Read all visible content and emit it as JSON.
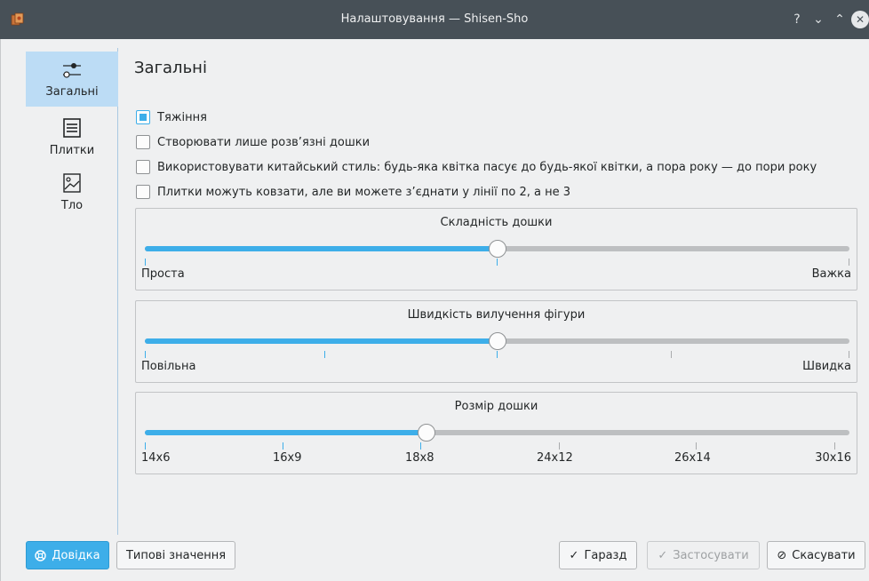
{
  "window": {
    "title": "Налаштовування — Shisen-Sho",
    "help_glyph": "?",
    "min_glyph": "⌄",
    "max_glyph": "⌃",
    "close_glyph": "✕"
  },
  "sidebar": {
    "items": [
      {
        "label": "Загальні",
        "icon": "sliders-icon",
        "active": true
      },
      {
        "label": "Плитки",
        "icon": "tiles-icon",
        "active": false
      },
      {
        "label": "Тло",
        "icon": "image-icon",
        "active": false
      }
    ]
  },
  "page": {
    "title": "Загальні"
  },
  "options": [
    {
      "label": "Тяжіння",
      "checked": true
    },
    {
      "label": "Створювати лише розв’язні дошки",
      "checked": false
    },
    {
      "label": "Використовувати китайський стиль: будь-яка квітка пасує до будь-якої квітки, а пора року — до пори року",
      "checked": false
    },
    {
      "label": "Плитки можуть ковзати, але ви можете з’єднати у лінії по 2, а не 3",
      "checked": false
    }
  ],
  "sliders": [
    {
      "title": "Складність дошки",
      "value_fraction": 0.5,
      "min_label": "Проста",
      "max_label": "Важка"
    },
    {
      "title": "Швидкість вилучення фігури",
      "value_fraction": 0.5,
      "min_label": "Повільна",
      "max_label": "Швидка"
    },
    {
      "title": "Розмір дошки",
      "value_fraction": 0.4,
      "labels": [
        "14x6",
        "16x9",
        "18x8",
        "24x12",
        "26x14",
        "30x16"
      ]
    }
  ],
  "buttons": {
    "help": "Довідка",
    "defaults": "Типові значення",
    "ok": "Гаразд",
    "apply": "Застосувати",
    "cancel": "Скасувати"
  },
  "colors": {
    "accent": "#3daee9",
    "titlebar": "#475057"
  }
}
